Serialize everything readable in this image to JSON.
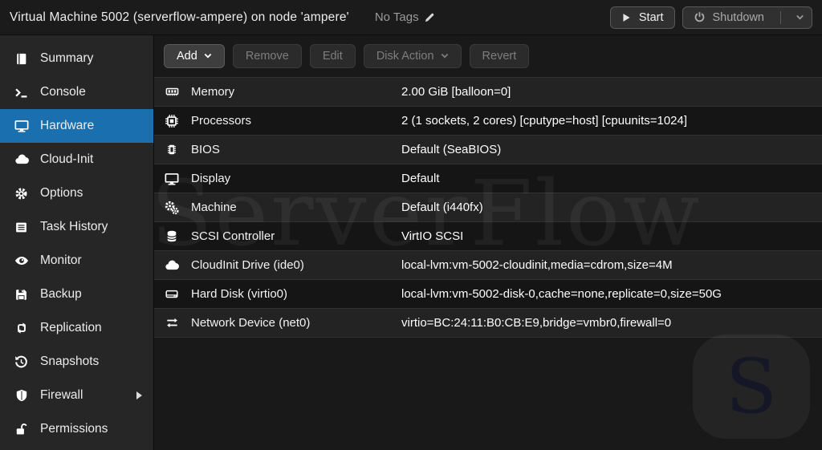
{
  "header": {
    "title": "Virtual Machine 5002 (serverflow-ampere) on node 'ampere'",
    "tags_label": "No Tags",
    "start_label": "Start",
    "shutdown_label": "Shutdown"
  },
  "sidebar": {
    "items": [
      {
        "label": "Summary",
        "icon": "book-icon",
        "selected": false
      },
      {
        "label": "Console",
        "icon": "terminal-icon",
        "selected": false
      },
      {
        "label": "Hardware",
        "icon": "display-icon",
        "selected": true
      },
      {
        "label": "Cloud-Init",
        "icon": "cloud-icon",
        "selected": false
      },
      {
        "label": "Options",
        "icon": "gear-icon",
        "selected": false
      },
      {
        "label": "Task History",
        "icon": "list-icon",
        "selected": false
      },
      {
        "label": "Monitor",
        "icon": "eye-icon",
        "selected": false
      },
      {
        "label": "Backup",
        "icon": "floppy-icon",
        "selected": false
      },
      {
        "label": "Replication",
        "icon": "sync-icon",
        "selected": false
      },
      {
        "label": "Snapshots",
        "icon": "history-icon",
        "selected": false
      },
      {
        "label": "Firewall",
        "icon": "shield-icon",
        "selected": false,
        "has_submenu": true
      },
      {
        "label": "Permissions",
        "icon": "unlock-icon",
        "selected": false
      }
    ]
  },
  "toolbar": {
    "buttons": [
      {
        "label": "Add",
        "enabled": true,
        "dropdown": true
      },
      {
        "label": "Remove",
        "enabled": false,
        "dropdown": false
      },
      {
        "label": "Edit",
        "enabled": false,
        "dropdown": false
      },
      {
        "label": "Disk Action",
        "enabled": false,
        "dropdown": true
      },
      {
        "label": "Revert",
        "enabled": false,
        "dropdown": false
      }
    ]
  },
  "hardware_rows": [
    {
      "icon": "memory-icon",
      "label": "Memory",
      "value": "2.00 GiB [balloon=0]"
    },
    {
      "icon": "cpu-icon",
      "label": "Processors",
      "value": "2 (1 sockets, 2 cores) [cputype=host] [cpuunits=1024]"
    },
    {
      "icon": "chip-icon",
      "label": "BIOS",
      "value": "Default (SeaBIOS)"
    },
    {
      "icon": "display-icon",
      "label": "Display",
      "value": "Default"
    },
    {
      "icon": "gears-icon",
      "label": "Machine",
      "value": "Default (i440fx)"
    },
    {
      "icon": "database-icon",
      "label": "SCSI Controller",
      "value": "VirtIO SCSI"
    },
    {
      "icon": "cloud-icon",
      "label": "CloudInit Drive (ide0)",
      "value": "local-lvm:vm-5002-cloudinit,media=cdrom,size=4M"
    },
    {
      "icon": "harddisk-icon",
      "label": "Hard Disk (virtio0)",
      "value": "local-lvm:vm-5002-disk-0,cache=none,replicate=0,size=50G"
    },
    {
      "icon": "network-icon",
      "label": "Network Device (net0)",
      "value": "virtio=BC:24:11:B0:CB:E9,bridge=vmbr0,firewall=0"
    }
  ],
  "watermark": {
    "text": "ServerFlow",
    "badge_letter": "S"
  },
  "colors": {
    "accent_selected": "#1a6fae",
    "row_light": "#232323",
    "row_dark": "#151515",
    "sidebar_bg": "#262626",
    "header_bg": "#1b1b1b"
  }
}
